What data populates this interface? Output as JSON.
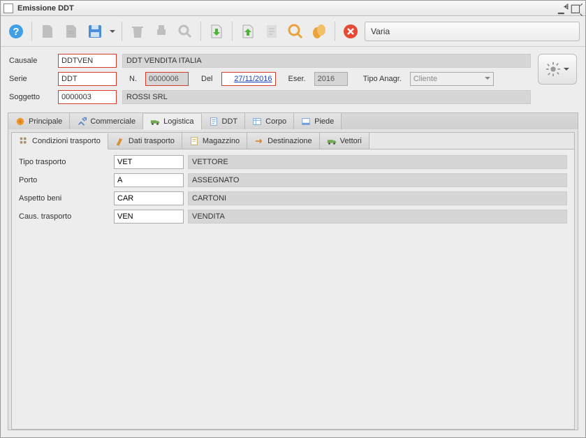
{
  "window": {
    "title": "Emissione DDT"
  },
  "toolbar": {
    "headfield": "Varia"
  },
  "form": {
    "causale": {
      "label": "Causale",
      "code": "DDTVEN",
      "desc": "DDT VENDITA ITALIA"
    },
    "serie": {
      "label": "Serie",
      "value": "DDT"
    },
    "numero": {
      "label": "N.",
      "value": "0000006"
    },
    "del": {
      "label": "Del",
      "value": "27/11/2016"
    },
    "eser": {
      "label": "Eser.",
      "value": "2016"
    },
    "tipo_anagr": {
      "label": "Tipo Anagr.",
      "value": "Cliente"
    },
    "soggetto": {
      "label": "Soggetto",
      "code": "0000003",
      "desc": "ROSSI SRL"
    }
  },
  "main_tabs": [
    "Principale",
    "Commerciale",
    "Logistica",
    "DDT",
    "Corpo",
    "Piede"
  ],
  "inner_tabs": [
    "Condizioni trasporto",
    "Dati trasporto",
    "Magazzino",
    "Destinazione",
    "Vettori"
  ],
  "fields": {
    "tipo_trasporto": {
      "label": "Tipo trasporto",
      "code": "VET",
      "desc": "VETTORE"
    },
    "porto": {
      "label": "Porto",
      "code": "A",
      "desc": "ASSEGNATO"
    },
    "aspetto_beni": {
      "label": "Aspetto beni",
      "code": "CAR",
      "desc": "CARTONI"
    },
    "caus_trasporto": {
      "label": "Caus. trasporto",
      "code": "VEN",
      "desc": "VENDITA"
    }
  }
}
